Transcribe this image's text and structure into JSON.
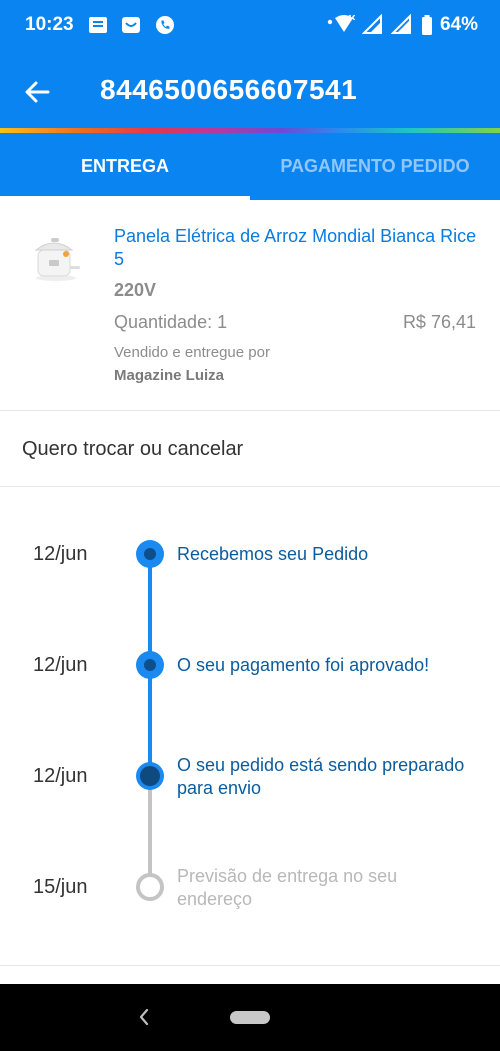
{
  "status_bar": {
    "time": "10:23",
    "app_icons": [
      "message-icon",
      "mail-icon",
      "phone-icon"
    ],
    "network": "4G+",
    "battery": "64%"
  },
  "header": {
    "order_number": "8446500656607541",
    "back_icon": "arrow-left-icon"
  },
  "tabs": [
    {
      "label": "ENTREGA",
      "active": true
    },
    {
      "label": "PAGAMENTO PEDIDO",
      "active": false
    }
  ],
  "product": {
    "name": "Panela Elétrica de Arroz Mondial Bianca Rice 5",
    "variant": "220V",
    "quantity": "Quantidade: 1",
    "price": "R$ 76,41",
    "sold_by_label": "Vendido e entregue por",
    "sold_by_store": "Magazine Luiza"
  },
  "exchange": {
    "label": "Quero trocar ou cancelar"
  },
  "timeline": [
    {
      "date": "12/jun",
      "text": "Recebemos seu Pedido",
      "status": "done"
    },
    {
      "date": "12/jun",
      "text": "O seu pagamento foi aprovado!",
      "status": "done"
    },
    {
      "date": "12/jun",
      "text": "O seu pedido está sendo preparado para envio",
      "status": "current"
    },
    {
      "date": "15/jun",
      "text": "Previsão de entrega no seu endereço",
      "status": "pending"
    }
  ],
  "colors": {
    "brand_blue": "#0a84f0",
    "timeline_blue": "#1a8af0",
    "link_blue": "#0a7be0",
    "pending_gray": "#c4c4c4"
  }
}
